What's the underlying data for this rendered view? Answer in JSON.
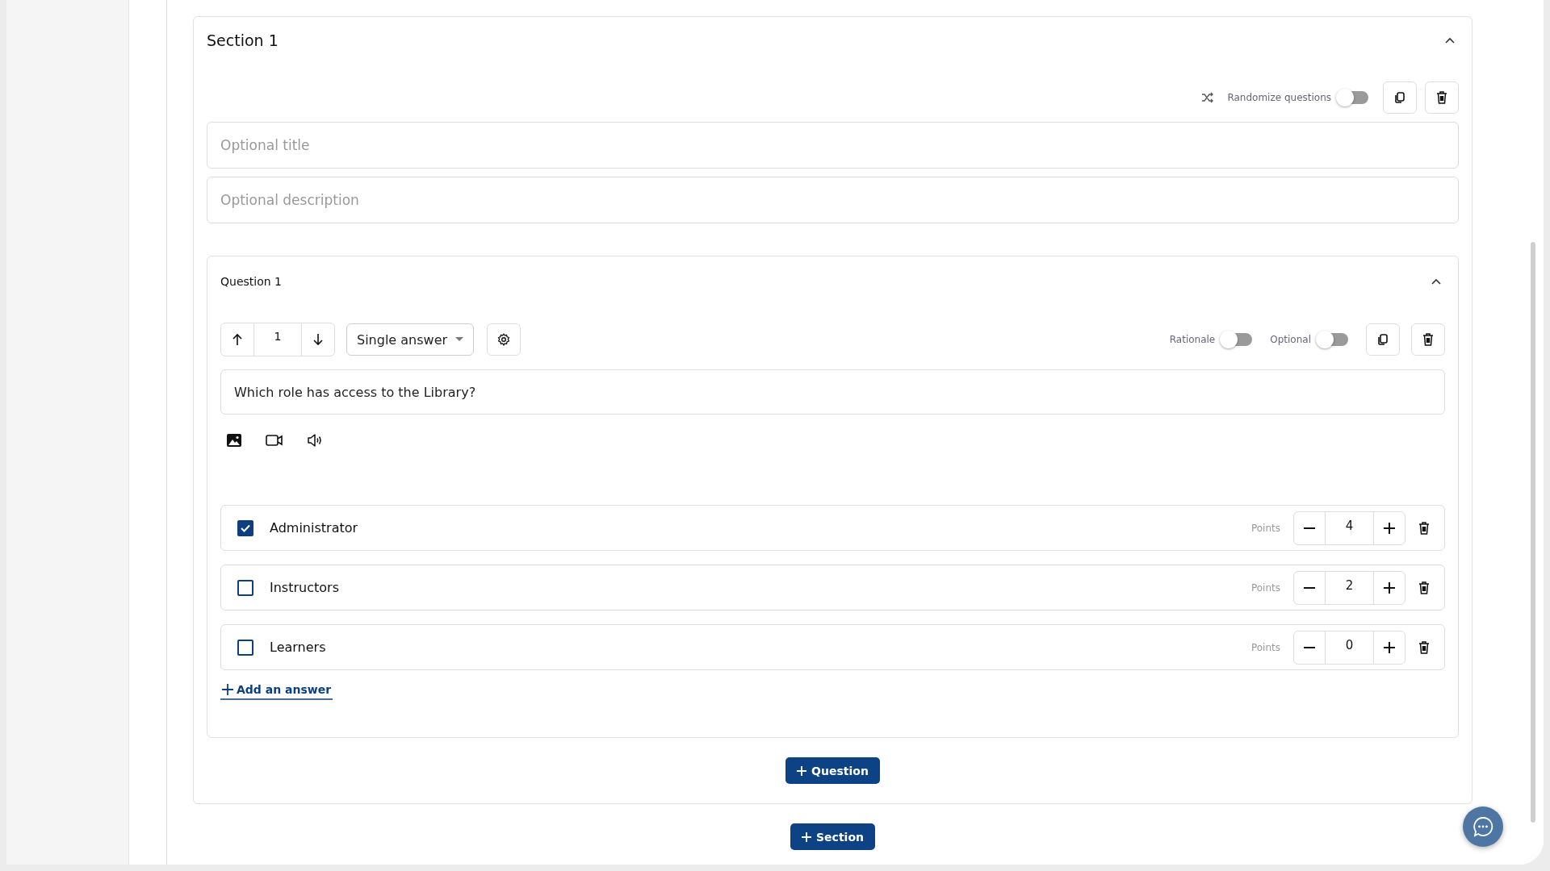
{
  "section": {
    "title": "Section 1",
    "expanded": true,
    "randomize": {
      "label": "Randomize questions",
      "on": false
    },
    "title_field": {
      "placeholder": "Optional title"
    },
    "description_field": {
      "placeholder": "Optional description"
    },
    "question": {
      "label": "Question 1",
      "expanded": true,
      "order": "1",
      "type": "Single answer",
      "rationale": {
        "label": "Rationale",
        "on": false
      },
      "optional": {
        "label": "Optional",
        "on": false
      },
      "text": "Which role has access to the Library?",
      "answers": [
        {
          "text": "Administrator",
          "checked": true,
          "points_label": "Points",
          "points": "4"
        },
        {
          "text": "Instructors",
          "checked": false,
          "points_label": "Points",
          "points": "2"
        },
        {
          "text": "Learners",
          "checked": false,
          "points_label": "Points",
          "points": "0"
        }
      ],
      "add_answer": "Add an answer"
    },
    "add_question": "Question"
  },
  "add_section": "Section"
}
